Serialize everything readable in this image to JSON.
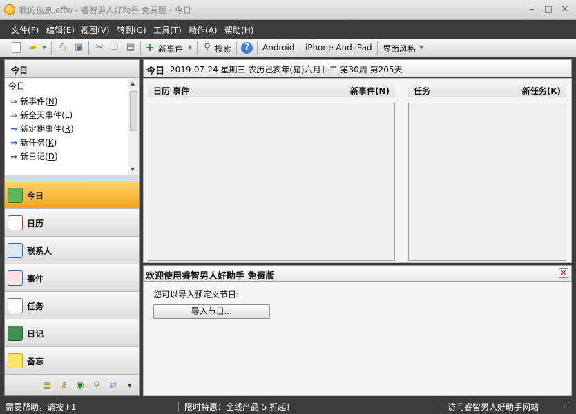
{
  "window": {
    "title": "我的信息.effw - 睿智男人好助手 免费版 - 今日"
  },
  "menu": [
    {
      "label": "文件(",
      "key": "F"
    },
    {
      "label": "编辑(",
      "key": "E"
    },
    {
      "label": "视图(",
      "key": "V"
    },
    {
      "label": "转到(",
      "key": "G"
    },
    {
      "label": "工具(",
      "key": "T"
    },
    {
      "label": "动作(",
      "key": "A"
    },
    {
      "label": "帮助(",
      "key": "H"
    }
  ],
  "toolbar": {
    "new_event": "新事件",
    "search": "搜索",
    "android": "Android",
    "iphone": "iPhone And iPad",
    "theme": "界面风格"
  },
  "left": {
    "today_header": "今日",
    "list_title": "今日",
    "items": [
      {
        "label": "新事件(",
        "key": "N"
      },
      {
        "label": "新全天事件(",
        "key": "L"
      },
      {
        "label": "新定期事件(",
        "key": "R"
      },
      {
        "label": "新任务(",
        "key": "K"
      },
      {
        "label": "新日记(",
        "key": "D"
      }
    ],
    "nav": [
      {
        "label": "今日"
      },
      {
        "label": "日历"
      },
      {
        "label": "联系人"
      },
      {
        "label": "事件"
      },
      {
        "label": "任务"
      },
      {
        "label": "日记"
      },
      {
        "label": "备忘"
      }
    ]
  },
  "header": {
    "today": "今日",
    "date": "2019-07-24 星期三 农历己亥年(猪)六月廿二  第30周 第205天"
  },
  "calendar": {
    "title": "日历  事件",
    "new_label": "新事件(",
    "new_key": "N"
  },
  "tasks": {
    "title": "任务",
    "new_label": "新任务(",
    "new_key": "K"
  },
  "welcome": {
    "title": "欢迎使用睿智男人好助手 免费版",
    "text": "您可以导入预定义节日:",
    "import": "导入节日..."
  },
  "status": {
    "help": "需要帮助，请按 F1",
    "promo": "限时特惠：全线产品 5 折起！",
    "visit": "访问睿智男人好助手网站"
  },
  "colors": {
    "accent": "#f7a21b",
    "status_bg": "#3c3c3c",
    "arrow": "#1c57b0"
  }
}
